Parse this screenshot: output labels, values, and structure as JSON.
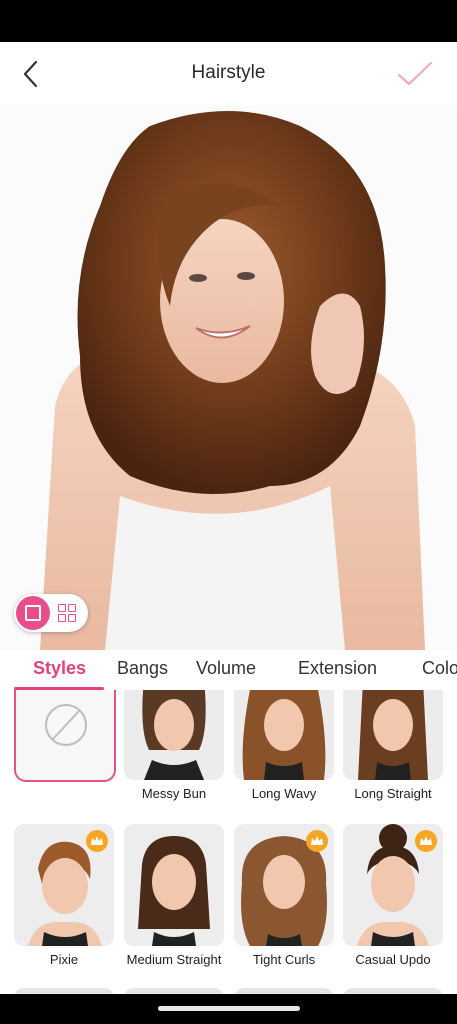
{
  "header": {
    "title": "Hairstyle",
    "accent_color": "#e84f8a"
  },
  "icons": {
    "back": "chevron-left-icon",
    "confirm": "checkmark-icon",
    "premium": "crown-icon",
    "none": "no-style-icon",
    "view_single": "single-view-icon",
    "view_grid": "grid-view-icon"
  },
  "tabs": [
    {
      "label": "Styles",
      "active": true
    },
    {
      "label": "Bangs",
      "active": false
    },
    {
      "label": "Volume",
      "active": false
    },
    {
      "label": "Extension",
      "active": false
    },
    {
      "label": "Colo",
      "active": false
    }
  ],
  "styles": [
    {
      "label": "",
      "selected": true,
      "premium": false
    },
    {
      "label": "Messy Bun",
      "premium": false
    },
    {
      "label": "Long Wavy",
      "premium": false
    },
    {
      "label": "Long Straight",
      "premium": false
    },
    {
      "label": "Pixie",
      "premium": true
    },
    {
      "label": "Medium Straight",
      "premium": false
    },
    {
      "label": "Tight Curls",
      "premium": true
    },
    {
      "label": "Casual Updo",
      "premium": true
    }
  ]
}
